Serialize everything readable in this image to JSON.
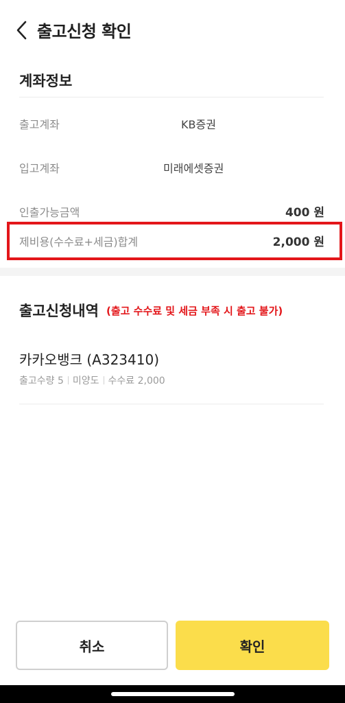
{
  "header": {
    "title": "출고신청 확인",
    "back_icon": "chevron-left-icon"
  },
  "account_info": {
    "title": "계좌정보",
    "rows": [
      {
        "label": "출고계좌",
        "value": "KB증권"
      },
      {
        "label": "입고계좌",
        "value": "미래에셋증권"
      },
      {
        "label": "인출가능금액",
        "value": "400 원"
      },
      {
        "label": "제비용(수수료+세금)합계",
        "value": "2,000 원"
      }
    ]
  },
  "withdrawal": {
    "title": "출고신청내역",
    "note": "(출고 수수료 및 세금 부족 시 출고 불가)",
    "item": {
      "name": "카카오뱅크 (A323410)",
      "meta": [
        "출고수량 5",
        "미양도",
        "수수료 2,000"
      ]
    }
  },
  "buttons": {
    "cancel": "취소",
    "confirm": "확인"
  },
  "colors": {
    "accent_yellow": "#fbdd4b",
    "highlight_red": "#e3161a"
  }
}
